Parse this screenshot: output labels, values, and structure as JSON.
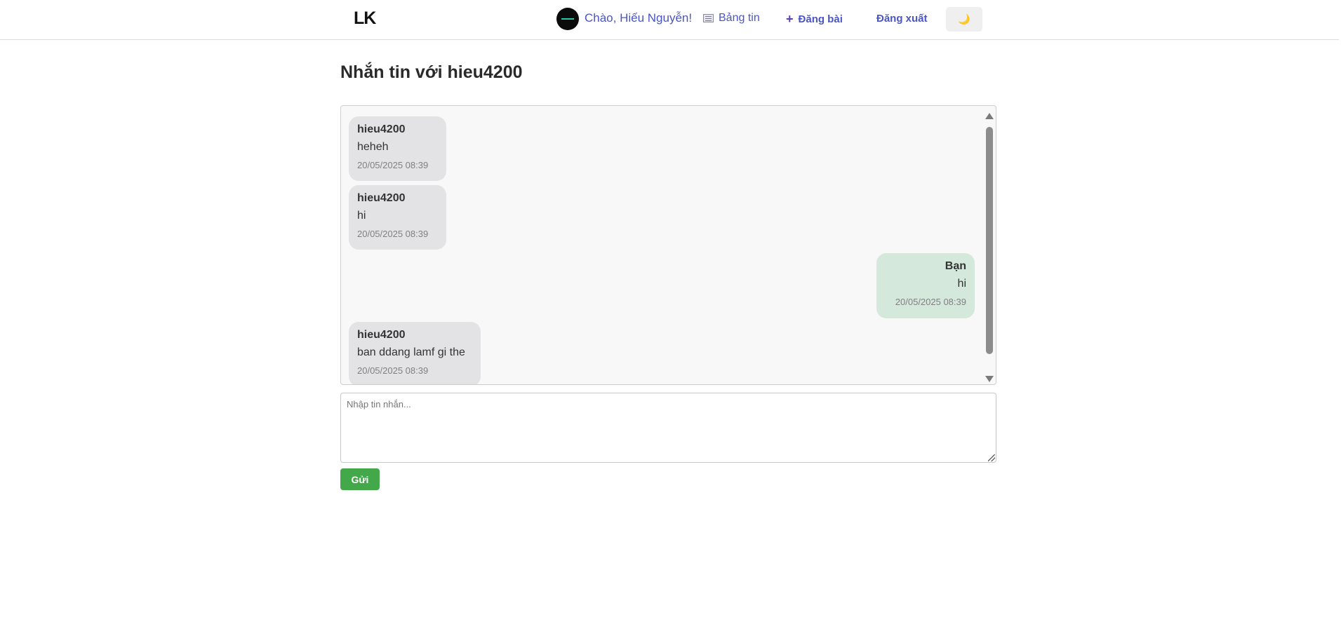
{
  "header": {
    "logo": "LK",
    "greeting": "Chào, Hiếu Nguyễn!",
    "nav": {
      "feed_label": "Bảng tin",
      "post_label": "Đăng bài",
      "logout_label": "Đăng xuất"
    },
    "theme_toggle_icon": "🌙"
  },
  "chat": {
    "title": "Nhắn tin với hieu4200",
    "messages": [
      {
        "sender": "hieu4200",
        "text": "heheh",
        "time": "20/05/2025 08:39",
        "side": "theirs"
      },
      {
        "sender": "hieu4200",
        "text": "hi",
        "time": "20/05/2025 08:39",
        "side": "theirs"
      },
      {
        "sender": "Bạn",
        "text": "hi",
        "time": "20/05/2025 08:39",
        "side": "mine"
      },
      {
        "sender": "hieu4200",
        "text": "ban ddang lamf gi the",
        "time": "20/05/2025 08:39",
        "side": "theirs"
      }
    ],
    "input_placeholder": "Nhập tin nhắn...",
    "input_value": "",
    "send_label": "Gửi"
  },
  "colors": {
    "accent_link": "#4a55c5",
    "send_button": "#43a84a",
    "their_bubble": "#e3e3e5",
    "my_bubble": "#d4e8dc"
  },
  "icons": {
    "feed": "newspaper-icon",
    "post": "plus-icon",
    "theme": "moon-icon",
    "avatar": "user-avatar"
  }
}
